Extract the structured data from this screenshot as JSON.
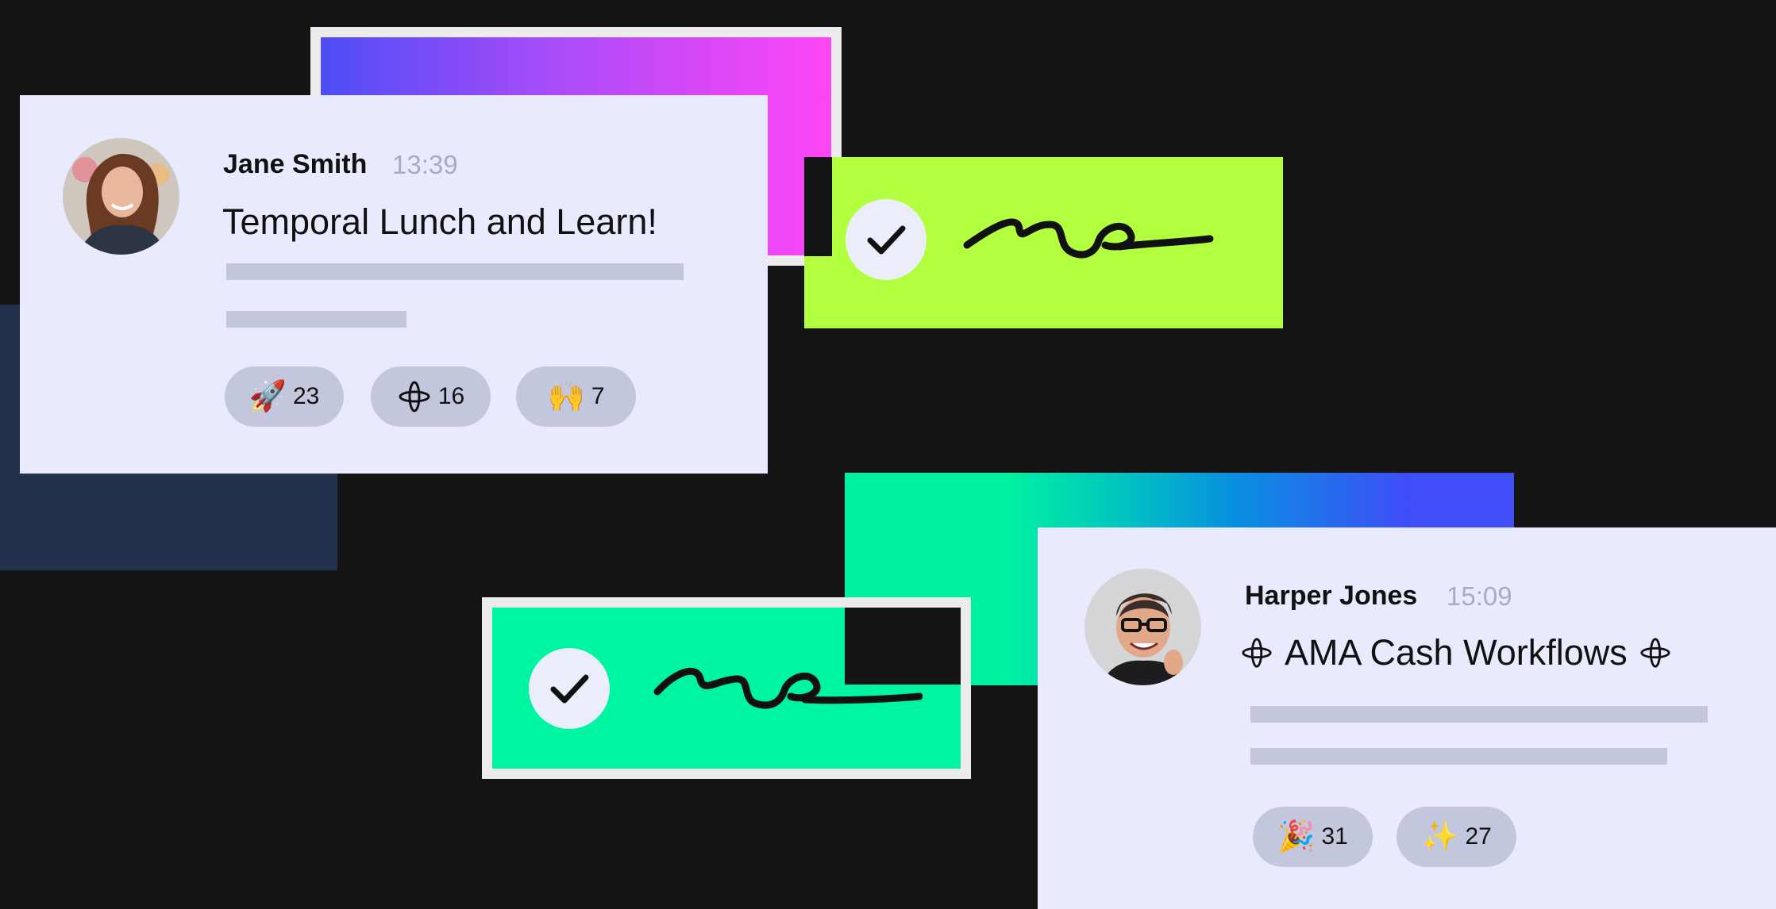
{
  "messages": [
    {
      "author": "Jane Smith",
      "time": "13:39",
      "title": "Temporal Lunch and Learn!",
      "reactions": [
        {
          "emoji": "🚀",
          "count": "23"
        },
        {
          "icon": "temporal-star-icon",
          "count": "16"
        },
        {
          "emoji": "🙌",
          "count": "7"
        }
      ]
    },
    {
      "author": "Harper Jones",
      "time": "15:09",
      "title": "AMA Cash Workflows",
      "reactions": [
        {
          "emoji": "🎉",
          "count": "31"
        },
        {
          "emoji": "✨",
          "count": "27"
        }
      ]
    }
  ],
  "approvals": [
    {
      "icon": "checkmark-icon",
      "signature": "signature-icon",
      "color": "#b1ff3e"
    },
    {
      "icon": "checkmark-icon",
      "signature": "signature-icon",
      "color": "#00f5a0"
    }
  ],
  "colors": {
    "background": "#141414",
    "card": "#e9eafd",
    "placeholder_bar": "#c3c7dd",
    "lime": "#b1ff3e",
    "mint": "#00f5a0",
    "navy": "#22324c",
    "magenta": "#ff45f5",
    "indigo": "#4d4df5"
  }
}
